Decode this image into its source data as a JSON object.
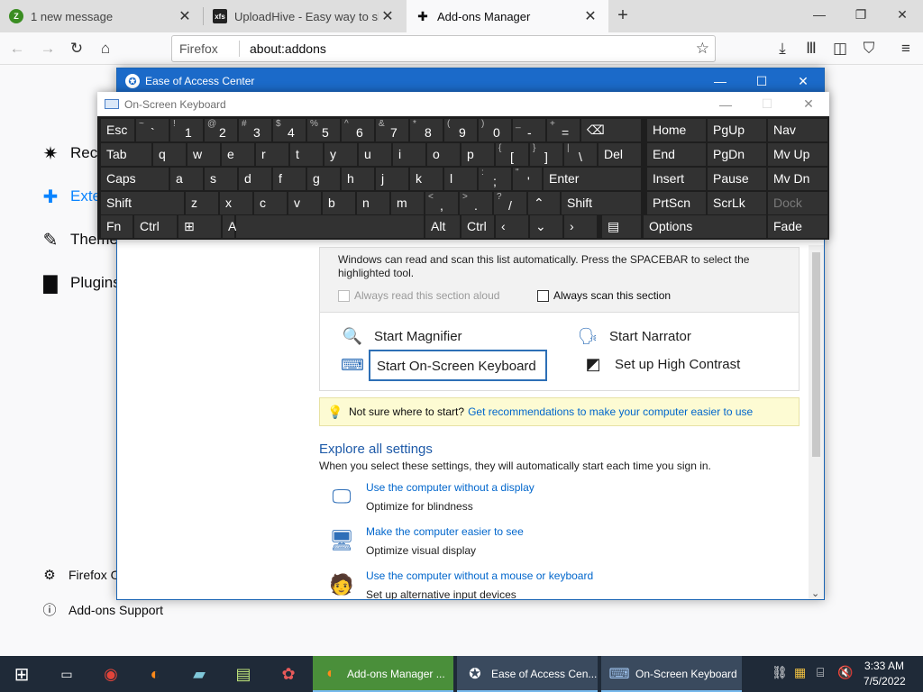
{
  "browser": {
    "tabs": [
      {
        "title": "1 new message",
        "favicon": "zimbra-icon",
        "favicon_color": "#3a8d22"
      },
      {
        "title": "UploadHive - Easy way to share",
        "favicon": "xfs-icon",
        "favicon_color": "#222222"
      },
      {
        "title": "Add-ons Manager",
        "favicon": "puzzle-icon",
        "favicon_color": "#0c0c0d"
      }
    ],
    "new_tab_symbol": "+",
    "identity_label": "Firefox",
    "url": "about:addons"
  },
  "addons": {
    "nav": [
      {
        "label": "Recommendations",
        "icon": "sparkle-icon"
      },
      {
        "label": "Extensions",
        "icon": "puzzle-icon"
      },
      {
        "label": "Themes",
        "icon": "brush-icon"
      },
      {
        "label": "Plugins",
        "icon": "plugin-icon"
      }
    ],
    "footer": [
      {
        "label": "Firefox Options",
        "icon": "gear-icon"
      },
      {
        "label": "Add-ons Support",
        "icon": "help-icon"
      }
    ]
  },
  "eoac": {
    "title": "Ease of Access Center",
    "scan_text": "Windows can read and scan this list automatically.  Press the SPACEBAR to select the highlighted tool.",
    "read_aloud_label": "Always read this section aloud",
    "scan_label": "Always scan this section",
    "tools": {
      "magnifier": "Start Magnifier",
      "narrator": "Start Narrator",
      "osk": "Start On-Screen Keyboard",
      "contrast": "Set up High Contrast"
    },
    "tip_text": "Not sure where to start?",
    "tip_link": "Get recommendations to make your computer easier to use",
    "explore_heading": "Explore all settings",
    "explore_sub": "When you select these settings, they will automatically start each time you sign in.",
    "settings": [
      {
        "link": "Use the computer without a display",
        "sub": "Optimize for blindness"
      },
      {
        "link": "Make the computer easier to see",
        "sub": "Optimize visual display"
      },
      {
        "link": "Use the computer without a mouse or keyboard",
        "sub": "Set up alternative input devices"
      }
    ]
  },
  "osk": {
    "title": "On-Screen Keyboard",
    "rows": [
      [
        {
          "l": "Esc"
        },
        {
          "s": "~",
          "m": "`"
        },
        {
          "s": "!",
          "m": "1"
        },
        {
          "s": "@",
          "m": "2"
        },
        {
          "s": "#",
          "m": "3"
        },
        {
          "s": "$",
          "m": "4"
        },
        {
          "s": "%",
          "m": "5"
        },
        {
          "s": "^",
          "m": "6"
        },
        {
          "s": "&",
          "m": "7"
        },
        {
          "s": "*",
          "m": "8"
        },
        {
          "s": "(",
          "m": "9"
        },
        {
          "s": ")",
          "m": "0"
        },
        {
          "s": "_",
          "m": "-"
        },
        {
          "s": "+",
          "m": "="
        },
        {
          "l": "⌫"
        },
        {
          "l": "Home"
        },
        {
          "l": "PgUp"
        },
        {
          "l": "Nav"
        }
      ],
      [
        {
          "l": "Tab"
        },
        {
          "l": "q"
        },
        {
          "l": "w"
        },
        {
          "l": "e"
        },
        {
          "l": "r"
        },
        {
          "l": "t"
        },
        {
          "l": "y"
        },
        {
          "l": "u"
        },
        {
          "l": "i"
        },
        {
          "l": "o"
        },
        {
          "l": "p"
        },
        {
          "s": "{",
          "m": "["
        },
        {
          "s": "}",
          "m": "]"
        },
        {
          "s": "|",
          "m": "\\"
        },
        {
          "l": "Del"
        },
        {
          "l": "End"
        },
        {
          "l": "PgDn"
        },
        {
          "l": "Mv Up"
        }
      ],
      [
        {
          "l": "Caps"
        },
        {
          "l": "a"
        },
        {
          "l": "s"
        },
        {
          "l": "d"
        },
        {
          "l": "f"
        },
        {
          "l": "g"
        },
        {
          "l": "h"
        },
        {
          "l": "j"
        },
        {
          "l": "k"
        },
        {
          "l": "l"
        },
        {
          "s": ":",
          "m": ";"
        },
        {
          "s": "\"",
          "m": "'"
        },
        {
          "l": "Enter"
        },
        {
          "l": "Insert"
        },
        {
          "l": "Pause"
        },
        {
          "l": "Mv Dn"
        }
      ],
      [
        {
          "l": "Shift"
        },
        {
          "l": "z"
        },
        {
          "l": "x"
        },
        {
          "l": "c"
        },
        {
          "l": "v"
        },
        {
          "l": "b"
        },
        {
          "l": "n"
        },
        {
          "l": "m"
        },
        {
          "s": "<",
          "m": ","
        },
        {
          "s": ">",
          "m": "."
        },
        {
          "s": "?",
          "m": "/"
        },
        {
          "l": "⌃"
        },
        {
          "l": "Shift"
        },
        {
          "l": "PrtScn"
        },
        {
          "l": "ScrLk"
        },
        {
          "l": "Dock"
        }
      ],
      [
        {
          "l": "Fn"
        },
        {
          "l": "Ctrl"
        },
        {
          "l": "⊞"
        },
        {
          "l": "Alt"
        },
        {
          "l": ""
        },
        {
          "l": "Alt"
        },
        {
          "l": "Ctrl"
        },
        {
          "l": "‹"
        },
        {
          "l": "⌄"
        },
        {
          "l": "›"
        },
        {
          "l": "▤"
        },
        {
          "l": "Options"
        },
        {
          "l": "Fade"
        }
      ]
    ]
  },
  "taskbar": {
    "tasks": [
      {
        "label": "Add-ons Manager ...",
        "icon": "firefox-icon"
      },
      {
        "label": "Ease of Access Cen...",
        "icon": "ease-of-access-icon"
      },
      {
        "label": "On-Screen Keyboard",
        "icon": "keyboard-icon"
      }
    ],
    "time": "3:33 AM",
    "date": "7/5/2022"
  }
}
